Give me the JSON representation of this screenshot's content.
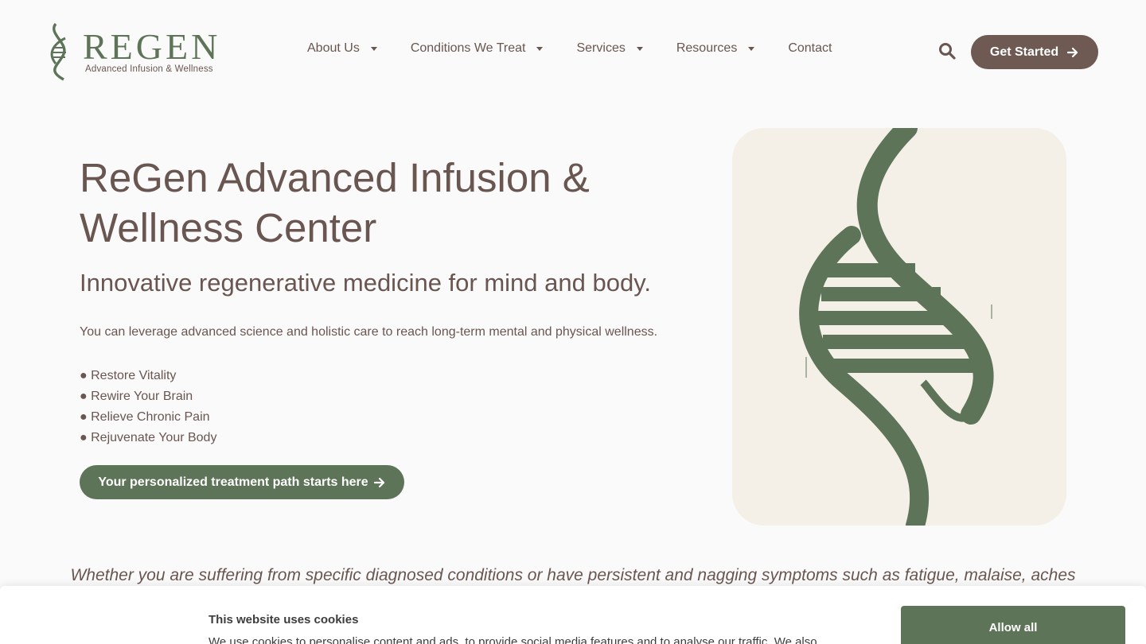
{
  "brand": {
    "name": "REGEN",
    "tagline": "Advanced Infusion & Wellness"
  },
  "nav": {
    "items": [
      {
        "label": "About Us",
        "has_dropdown": true
      },
      {
        "label": "Conditions We Treat",
        "has_dropdown": true
      },
      {
        "label": "Services",
        "has_dropdown": true
      },
      {
        "label": "Resources",
        "has_dropdown": true
      },
      {
        "label": "Contact",
        "has_dropdown": false
      }
    ],
    "cta_label": "Get Started"
  },
  "hero": {
    "title": "ReGen Advanced Infusion & Wellness Center",
    "subtitle": "Innovative regenerative medicine for mind and body.",
    "description": "You can leverage advanced science and holistic care to reach long-term mental and physical wellness.",
    "bullets": [
      "● Restore Vitality",
      "● Rewire Your Brain",
      "● Relieve Chronic Pain",
      "● Rejuvenate Your Body"
    ],
    "cta_label": "Your personalized treatment path starts here"
  },
  "intro": {
    "text": "Whether you are suffering from specific diagnosed conditions or have persistent and nagging symptoms such as fatigue, malaise, aches"
  },
  "cookie": {
    "title": "This website uses cookies",
    "text": "We use cookies to personalise content and ads, to provide social media features and to analyse our traffic. We also",
    "allow_label": "Allow all"
  },
  "colors": {
    "brand_green": "#5e7458",
    "brand_brown": "#6e5a52",
    "text": "#6a5650",
    "panel_bg": "#f4f0e8"
  }
}
